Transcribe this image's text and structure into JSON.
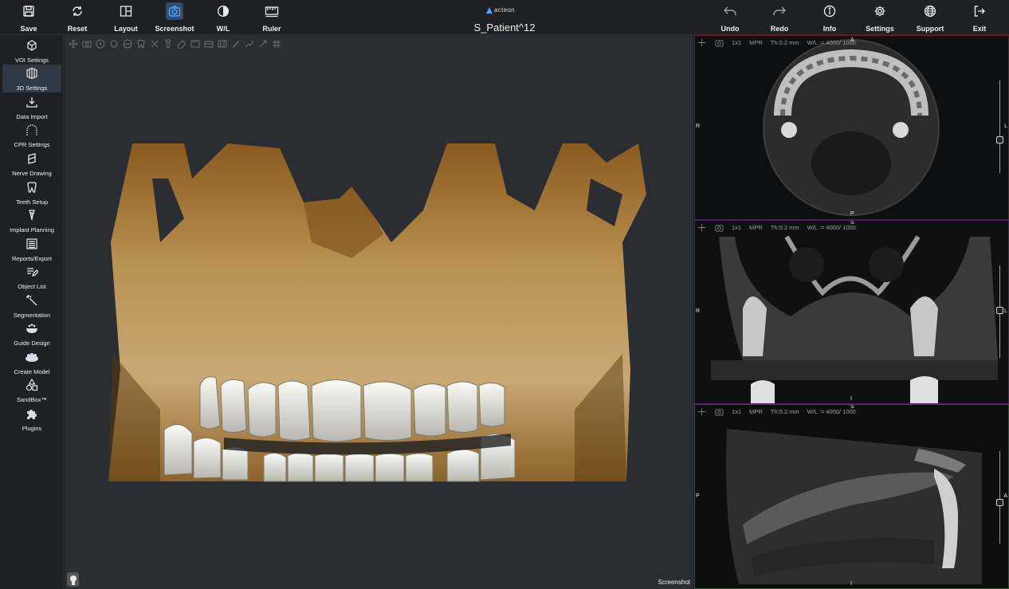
{
  "toolbar": {
    "left": [
      {
        "label": "Save",
        "icon": "save-icon"
      },
      {
        "label": "Reset",
        "icon": "reset-icon"
      },
      {
        "label": "Layout",
        "icon": "layout-icon"
      },
      {
        "label": "Screenshot",
        "icon": "camera-icon"
      },
      {
        "label": "W/L",
        "icon": "contrast-icon"
      },
      {
        "label": "Ruler",
        "icon": "ruler-icon"
      }
    ],
    "right": [
      {
        "label": "Undo",
        "icon": "undo-icon"
      },
      {
        "label": "Redo",
        "icon": "redo-icon"
      },
      {
        "label": "Info",
        "icon": "info-icon"
      },
      {
        "label": "Settings",
        "icon": "gear-icon"
      },
      {
        "label": "Support",
        "icon": "globe-icon"
      },
      {
        "label": "Exit",
        "icon": "exit-icon"
      }
    ],
    "brand": "acteon",
    "patient": "S_Patient^12"
  },
  "sidebar": {
    "items": [
      {
        "label": "VOI Settings",
        "icon": "cube-icon"
      },
      {
        "label": "3D Settings",
        "icon": "3d-cube-icon",
        "selected": true
      },
      {
        "label": "Data Import",
        "icon": "download-icon"
      },
      {
        "label": "CPR Settings",
        "icon": "arch-icon"
      },
      {
        "label": "Nerve Drawing",
        "icon": "nerve-icon"
      },
      {
        "label": "Teeth Setup",
        "icon": "tooth-icon"
      },
      {
        "label": "Implant Planning",
        "icon": "implant-icon"
      },
      {
        "label": "Reports/Export",
        "icon": "report-icon"
      },
      {
        "label": "Object List",
        "icon": "list-edit-icon"
      },
      {
        "label": "Segmentation",
        "icon": "wand-icon"
      },
      {
        "label": "Guide Design",
        "icon": "guide-icon"
      },
      {
        "label": "Create Model",
        "icon": "model-icon"
      },
      {
        "label": "SandBox™",
        "icon": "shapes-icon"
      },
      {
        "label": "Plugins",
        "icon": "puzzle-icon"
      }
    ]
  },
  "view3d": {
    "screenshot_label": "Screenshot"
  },
  "panes": [
    {
      "layout": "1x1",
      "mode": "MPR",
      "thickness": "Th:0.2 mm",
      "wl": "W/L := 4000/ 1000",
      "top": "A",
      "bottom": "P",
      "left": "R",
      "right": "L",
      "border": "#6b1b26"
    },
    {
      "layout": "1x1",
      "mode": "MPR",
      "thickness": "Th:0.2 mm",
      "wl": "W/L := 4000/ 1000",
      "top": "S",
      "bottom": "I",
      "left": "R",
      "right": "L",
      "border": "#4d2060"
    },
    {
      "layout": "1x1",
      "mode": "MPR",
      "thickness": "Th:0.2 mm",
      "wl": "W/L := 4000/ 1000",
      "top": "S",
      "bottom": "I",
      "left": "P",
      "right": "A",
      "border": "#2c5a2c"
    }
  ],
  "colors": {
    "accent": "#4aa3ff",
    "bone": "#c9a56a",
    "tooth": "#eeeeea",
    "background": "#2a2d31"
  }
}
